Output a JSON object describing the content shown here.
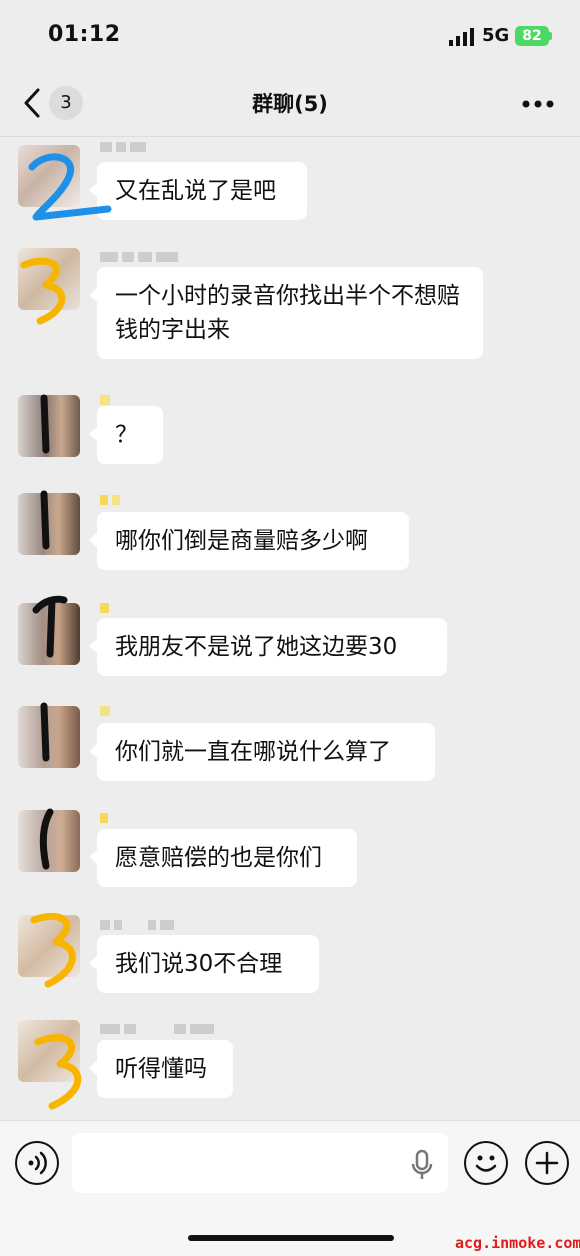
{
  "status": {
    "time": "01:12",
    "network": "5G",
    "battery": "82"
  },
  "nav": {
    "back_count": "3",
    "title": "群聊(5)"
  },
  "messages": [
    {
      "text": "又在乱说了是吧"
    },
    {
      "text": "一个小时的录音你找出半个不想赔钱的字出来"
    },
    {
      "text": "？"
    },
    {
      "text": "哪你们倒是商量赔多少啊"
    },
    {
      "text": "我朋友不是说了她这边要30"
    },
    {
      "text": "你们就一直在哪说什么算了"
    },
    {
      "text": "愿意赔偿的也是你们"
    },
    {
      "text": "我们说30不合理"
    },
    {
      "text": "听得懂吗"
    }
  ],
  "watermark": "acg.inmoke.com",
  "colors": {
    "background": "#ededed",
    "bubble": "#ffffff",
    "battery": "#4cd964",
    "mark_blue": "#1e90e8",
    "mark_yellow": "#f7b500",
    "mark_black": "#111111",
    "watermark": "#e21c1c"
  }
}
